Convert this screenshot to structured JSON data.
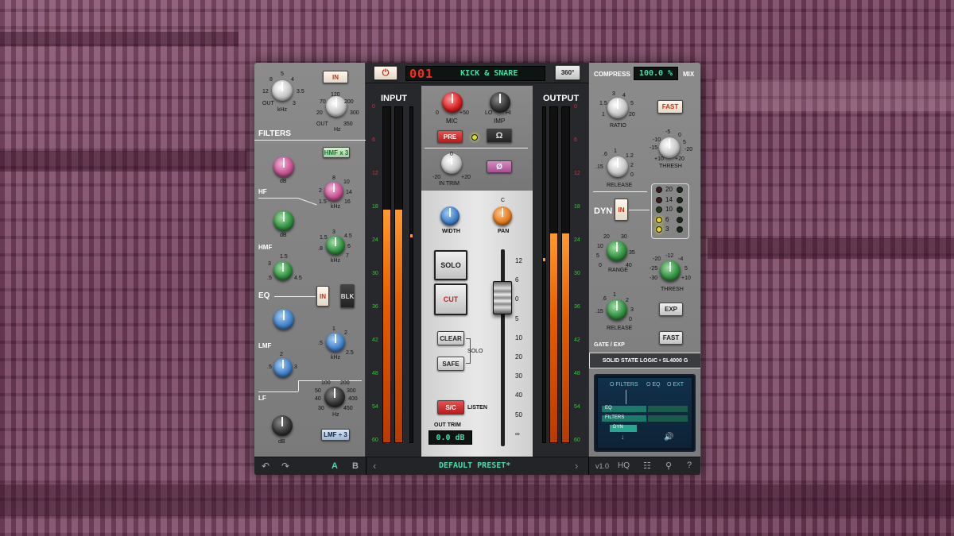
{
  "header": {
    "preset_number": "001",
    "preset_name": "KICK & SNARE",
    "view_button": "360°",
    "power_icon": "power-icon"
  },
  "left": {
    "in_button": "IN",
    "hpf_knob": {
      "scale": [
        "5",
        "8",
        "4",
        "12",
        "3.5",
        "OUT",
        "3"
      ],
      "unit": "kHz"
    },
    "lpf_knob": {
      "scale": [
        "120",
        "70",
        "200",
        "20",
        "300",
        "OUT",
        "350"
      ],
      "unit": "Hz"
    },
    "filters_label": "FILTERS",
    "hmf_x3": "HMF x 3",
    "hf_label": "HF",
    "hf_gain_unit": "dB",
    "hf_freq_scale": [
      "8",
      "10",
      "2",
      "14",
      "1.5",
      "16"
    ],
    "hf_freq_unit": "kHz",
    "hmf_label": "HMF",
    "hmf_gain_unit": "dB",
    "hmf_freq_scale": [
      "3",
      "1.5",
      "4.5",
      "6",
      ".8",
      "7"
    ],
    "hmf_freq_unit": "kHz",
    "hmf_q_scale": [
      "1.5",
      "3",
      ".5",
      "4.5"
    ],
    "eq_label": "EQ",
    "eq_in": "IN",
    "eq_blk": "BLK",
    "lmf_label": "LMF",
    "lmf_q_scale": [
      "1.5",
      "2.5",
      "3",
      ".5"
    ],
    "lmf_freq_scale": [
      "1",
      "2",
      ".5",
      "2.5"
    ],
    "lmf_freq_unit": "kHz",
    "lmf_gain_scale": [
      "2",
      "3",
      ".5"
    ],
    "lf_label": "LF",
    "lf_freq_scale": [
      "100",
      "200",
      "50",
      "300",
      "40",
      "400",
      "30",
      "450"
    ],
    "lf_freq_unit": "Hz",
    "lf_gain_unit": "dB",
    "lmf_x3": "LMF ÷ 3"
  },
  "center": {
    "input_label": "INPUT",
    "output_label": "OUTPUT",
    "meter_scale": [
      "0",
      "6",
      "12",
      "18",
      "24",
      "30",
      "36",
      "42",
      "48",
      "54",
      "60"
    ],
    "input_level": 0.69,
    "output_level": 0.62,
    "mic_label": "MIC",
    "mic_scale": [
      "0",
      "+50"
    ],
    "imp_label": "IMP",
    "imp_scale": [
      "LO",
      "HI"
    ],
    "pre_button": "PRE",
    "ohm_button": "Ω",
    "in_trim_label": "IN TRIM",
    "in_trim_scale": [
      "-20",
      "0",
      "+20"
    ],
    "phase_button": "Ø",
    "width_label": "WIDTH",
    "pan_label": "PAN",
    "pan_center": "C",
    "solo_button": "SOLO",
    "cut_button": "CUT",
    "clear_button": "CLEAR",
    "safe_button": "SAFE",
    "solo_group": "SOLO",
    "sc_button": "S/C",
    "listen_label": "LISTEN",
    "out_trim_label": "OUT TRIM",
    "out_trim_value": "0.0 dB",
    "fader_scale": [
      "12",
      "6",
      "0",
      "5",
      "10",
      "20",
      "30",
      "40",
      "50",
      "∞"
    ],
    "fader_level_db": 0
  },
  "right": {
    "compress_label": "COMPRESS",
    "mix_value": "100.0 %",
    "mix_label": "MIX",
    "ratio_label": "RATIO",
    "ratio_scale": [
      "3",
      "4",
      "1.5",
      "5",
      "1",
      "20"
    ],
    "fast_button": "FAST",
    "thresh_label": "THRESH",
    "thresh_scale": [
      "-5",
      "0",
      "-10",
      "5",
      "-15",
      "-20",
      "+10",
      "+20"
    ],
    "release_label": "RELEASE",
    "release_scale": [
      "1",
      ".6",
      "1.2",
      ".15",
      "2",
      "0"
    ],
    "dyn_label": "DYN",
    "dyn_in": "IN",
    "gr_scale": [
      "20",
      "14",
      "10",
      "6",
      "3"
    ],
    "range_label": "RANGE",
    "range_scale": [
      "20",
      "10",
      "30",
      "5",
      "35",
      "0",
      "40"
    ],
    "gate_thresh_label": "THRESH",
    "gate_thresh_scale": [
      "-12",
      "-20",
      "-4",
      "-25",
      "5",
      "-30",
      "+10"
    ],
    "gate_release_label": "RELEASE",
    "gate_release_scale": [
      "1",
      ".6",
      "2",
      ".15",
      "3",
      "0"
    ],
    "exp_button": "EXP",
    "gate_fast_button": "FAST",
    "gate_exp_label": "GATE / EXP",
    "brand": "SOLID STATE LOGIC • SL4000 G",
    "routing_tabs": [
      "O FILTERS",
      "O EQ",
      "O EXT"
    ],
    "routing_items": [
      "EQ",
      "FILTERS",
      "DYN"
    ]
  },
  "footer": {
    "undo_icon": "undo-icon",
    "redo_icon": "redo-icon",
    "a_button": "A",
    "b_button": "B",
    "prev_icon": "chevron-left-icon",
    "preset_name": "DEFAULT PRESET*",
    "next_icon": "chevron-right-icon",
    "version": "v1.0",
    "hq_button": "HQ",
    "settings_icon": "sliders-icon",
    "zoom_icon": "search-icon",
    "help_icon": "help-icon",
    "accent_color": "#3fe0a6"
  }
}
